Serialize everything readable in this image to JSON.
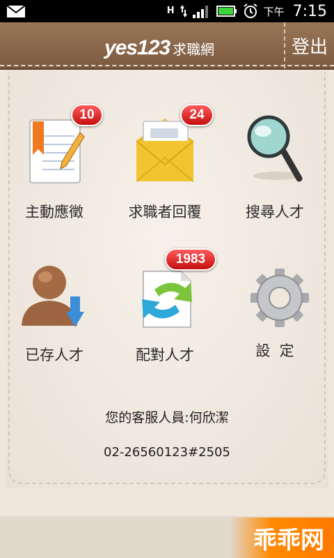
{
  "status_bar": {
    "network": "H",
    "ampm": "下午",
    "time": "7:15"
  },
  "header": {
    "logo_main": "yes123",
    "logo_sub": "求職網",
    "logout_label": "登出"
  },
  "menu": [
    {
      "label": "主動應徵",
      "icon": "resume-bookmark-icon",
      "badge": "10"
    },
    {
      "label": "求職者回覆",
      "icon": "envelope-icon",
      "badge": "24"
    },
    {
      "label": "搜尋人才",
      "icon": "magnifier-icon",
      "badge": ""
    },
    {
      "label": "已存人才",
      "icon": "saved-person-icon",
      "badge": ""
    },
    {
      "label": "配對人才",
      "icon": "match-arrows-icon",
      "badge": "1983"
    },
    {
      "label": "設  定",
      "icon": "gear-icon",
      "badge": ""
    }
  ],
  "contact": {
    "service_line": "您的客服人員:何欣潔",
    "phone": "02-26560123#2505"
  },
  "watermark": "乖乖网",
  "colors": {
    "header": "#86634a",
    "badge": "#d91f1f",
    "background": "#efe7dc"
  }
}
